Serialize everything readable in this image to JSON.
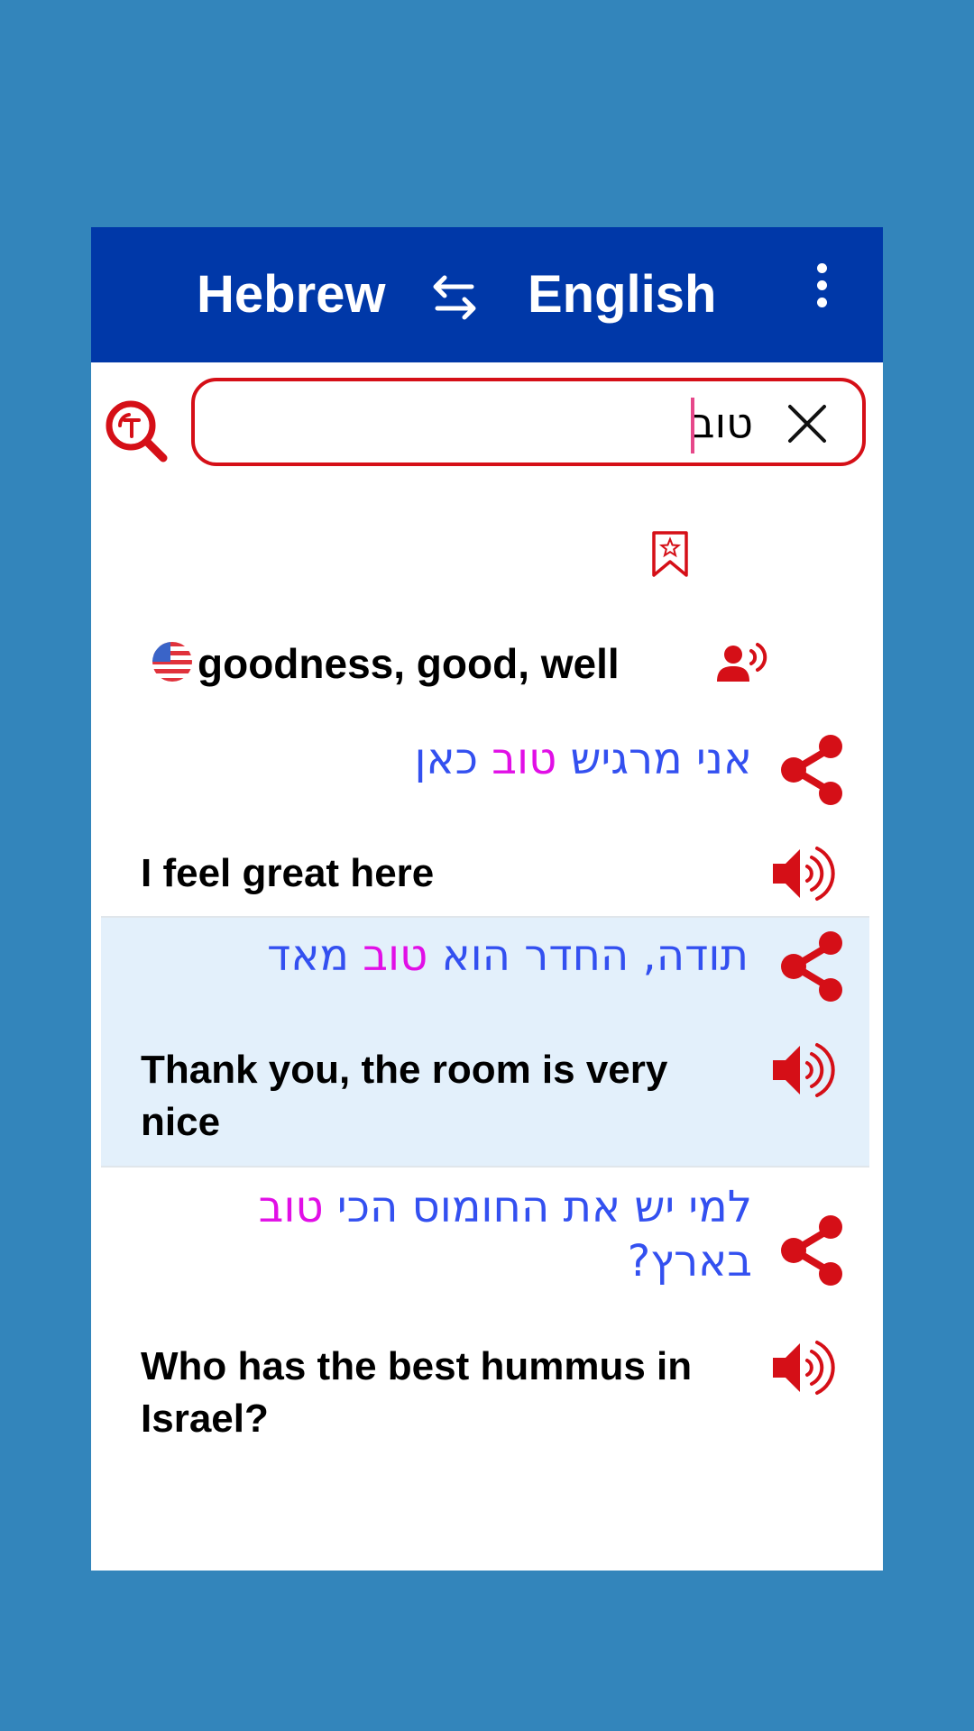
{
  "header": {
    "source_language": "Hebrew",
    "target_language": "English",
    "swap_icon": "swap-arrows-icon",
    "menu_icon": "more-vertical-icon"
  },
  "search": {
    "value": "טוב",
    "lookup_icon": "text-search-icon",
    "clear_icon": "close-icon"
  },
  "result": {
    "bookmark_icon": "bookmark-star-icon",
    "flag_icon": "us-flag-icon",
    "meaning": "goodness, good, well",
    "pronounce_icon": "speaking-person-icon"
  },
  "examples": [
    {
      "hebrew_before": "אני מרגיש ",
      "keyword": "טוב",
      "hebrew_after": " כאן",
      "english": "I feel great here",
      "highlighted": false
    },
    {
      "hebrew_before": "תודה, החדר הוא ",
      "keyword": "טוב",
      "hebrew_after": " מאד",
      "english": "Thank you, the room is very nice",
      "highlighted": true
    },
    {
      "hebrew_before": "למי יש את החומוס הכי ",
      "keyword": "טוב",
      "hebrew_after": " בארץ?",
      "english": "Who has the best hummus in Israel?",
      "highlighted": false
    }
  ],
  "colors": {
    "background": "#3385bb",
    "topbar": "#0038a8",
    "accent_red": "#d50f17",
    "hebrew_text": "#3350f0",
    "keyword": "#e10fe6",
    "highlight_row": "#e3f0fb"
  }
}
